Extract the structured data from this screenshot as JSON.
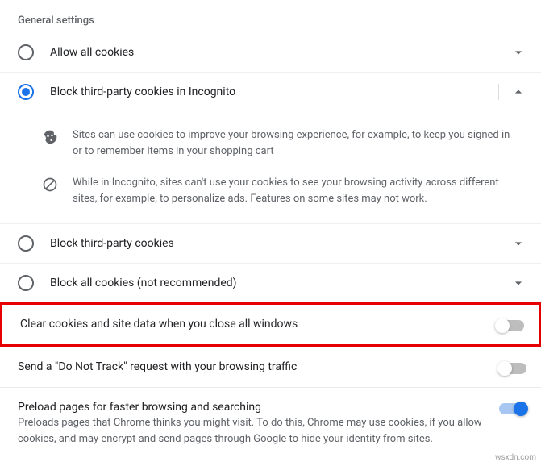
{
  "section_title": "General settings",
  "options": {
    "allow_all": {
      "label": "Allow all cookies"
    },
    "block_tp_incognito": {
      "label": "Block third-party cookies in Incognito",
      "detail_1": "Sites can use cookies to improve your browsing experience, for example, to keep you signed in or to remember items in your shopping cart",
      "detail_2": "While in Incognito, sites can't use your cookies to see your browsing activity across different sites, for example, to personalize ads. Features on some sites may not work."
    },
    "block_tp": {
      "label": "Block third-party cookies"
    },
    "block_all": {
      "label": "Block all cookies (not recommended)"
    }
  },
  "toggles": {
    "clear_on_close": {
      "label": "Clear cookies and site data when you close all windows"
    },
    "dnt": {
      "label": "Send a \"Do Not Track\" request with your browsing traffic"
    },
    "preload": {
      "label": "Preload pages for faster browsing and searching",
      "desc": "Preloads pages that Chrome thinks you might visit. To do this, Chrome may use cookies, if you allow cookies, and may encrypt and send pages through Google to hide your identity from sites."
    }
  },
  "watermark": "wsxdn.com"
}
